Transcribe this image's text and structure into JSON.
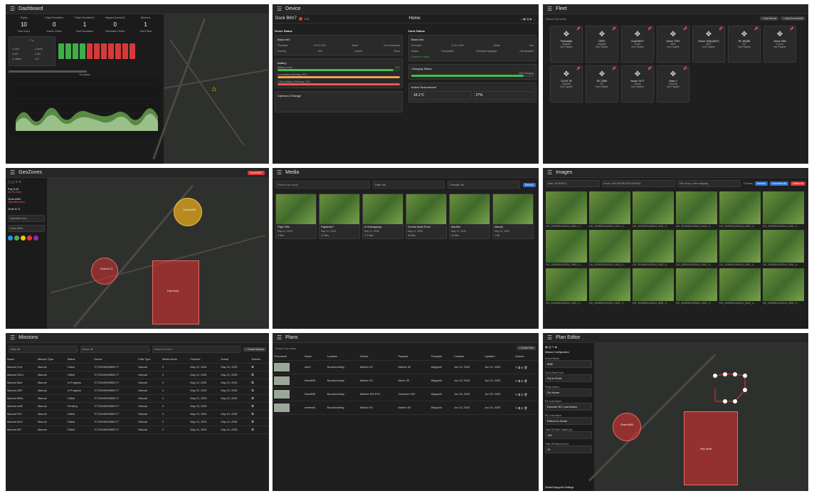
{
  "dashboard": {
    "title": "Dashboard",
    "stats": [
      {
        "label": "Flights",
        "value": "10",
        "sub": "Total Hours"
      },
      {
        "label": "Flight Simulation",
        "value": "0",
        "sub": "Assets Online"
      },
      {
        "label": "Flight Simulation2",
        "value": "1",
        "sub": "Total Simulation"
      },
      {
        "label": "Mapped Area(m2)",
        "value": "0",
        "sub": "Simulation Online"
      },
      {
        "label": "Missions",
        "value": "1",
        "sub": "Total Plans"
      }
    ],
    "fly_status": "Fly status",
    "battery_label": "Fly"
  },
  "device": {
    "title": "Device",
    "dock_name": "Dock B6V7",
    "dji_label": "DJI",
    "home_label": "Home",
    "drone_status": "Drone Status",
    "dock_status": "Dock Status",
    "basic_info": "Basic Info",
    "battery": "Battery",
    "camera_storage": "Camera & Storage",
    "charging_status": "Charging Status",
    "indoor_env": "Indoor Environment",
    "firmware": "Firmware",
    "firmware_val": "10.01.1001",
    "mode": "Mode",
    "mode_val": "Not connected",
    "country": "Country",
    "country_val": "N/A",
    "control": "Control",
    "control_val": "Rock",
    "battery_level": "Battery Level",
    "battery_pct": "29%",
    "low_batt": "Low Battery Warning: 30%",
    "crit_batt": "Critical Battery Warning: 10%",
    "temp_val": "18.1°C",
    "humidity_val": "27%",
    "charging_state": "Not Charging",
    "dock_mode": "Idle",
    "status": "Status",
    "status_val": "Compatible",
    "firmware_upgrade": "Firmware Upgrade",
    "fu_val": "Not Updated",
    "drone_in_dock": "Drone is in dock"
  },
  "fleet": {
    "title": "Fleet",
    "search": "Search by name",
    "add_device": "+ Add Device",
    "add_dock": "+ Add Dock Model",
    "items": [
      {
        "name": "Testzastrip",
        "sub": "Adapter",
        "status": "Not Flyable"
      },
      {
        "name": "GPR1",
        "sub": "Adapter",
        "status": "Not Flyable"
      },
      {
        "name": "Dock B6V7",
        "sub": "Dock",
        "status": "Not Flyable"
      },
      {
        "name": "Drone 7V9X",
        "sub": "M30",
        "status": "Not Flyable"
      },
      {
        "name": "Drone JX4A (M3T)",
        "sub": "M3T",
        "status": "Not Flyable"
      },
      {
        "name": "RC WQ8N",
        "sub": "RC",
        "status": "Not Flyable"
      },
      {
        "name": "Drone 0SB",
        "sub": "Drone",
        "status": "Not Flyable"
      },
      {
        "name": "DJI AT 25",
        "sub": "Camera",
        "status": "Not Flyable"
      },
      {
        "name": "RC 2S83",
        "sub": "RC",
        "status": "Not Flyable"
      },
      {
        "name": "Drone 7A7T",
        "sub": "Drone",
        "status": "Not Flyable"
      },
      {
        "name": "Video 1",
        "sub": "Camera",
        "status": "Not Flyable"
      }
    ]
  },
  "geozones": {
    "title": "GeoZones",
    "dock_btn": "Dock B6V7",
    "zones": [
      {
        "name": "Poly N-29",
        "type": "No Fly Zone"
      },
      {
        "name": "Circle A453",
        "type": "Operation Area"
      },
      {
        "name": "Circle N-71",
        "type": ""
      }
    ],
    "field_label": "Operation Area",
    "name_label": "Circle A453",
    "labels": {
      "circle_a": "Circle A453",
      "circle_b": "Circle N-71",
      "poly": "Poly Scott"
    }
  },
  "media": {
    "title": "Media",
    "search": "Search by name",
    "filter1": "Date: All",
    "filter2": "Format: All",
    "refresh": "Refresh",
    "items": [
      {
        "name": "Flight 7e5e",
        "date": "May 11, 2025",
        "count": "4 files"
      },
      {
        "name": "Flightcode7",
        "date": "May 11, 2025",
        "count": "21 files"
      },
      {
        "name": "et Geomapping",
        "date": "May 11, 2025",
        "count": "172 files"
      },
      {
        "name": "Circular Aerial Event",
        "date": "May 11, 2025",
        "count": "36 files"
      },
      {
        "name": "Niceflix4",
        "date": "May 11, 2025",
        "count": "18 files"
      },
      {
        "name": "Manual",
        "date": "May 11, 2025",
        "count": "1 file"
      }
    ]
  },
  "images": {
    "title": "Images",
    "filter1": "Date: 2025/05/11",
    "filter2": "Drone: 5DCF8F4B23FA7E2E3A4",
    "filter3": "File Group: ortho mapping",
    "count": "72 Items",
    "refresh": "Refresh",
    "download": "Download All",
    "delete": "Delete All",
    "caption": "DJI_20250511102514_0001_V..."
  },
  "missions": {
    "title": "Missions",
    "filter1": "Date: All",
    "filter2": "Drone: All",
    "search": "Search by name",
    "create": "+ Create Mission",
    "headers": [
      "Name",
      "Mission Type",
      "Status",
      "Device",
      "Path Type",
      "Media Items",
      "Planned",
      "Actual",
      "Actions"
    ],
    "rows": [
      {
        "name": "Manual 4Yre",
        "type": "Manual",
        "sub": "1 Key Takeoff",
        "status": "Failed",
        "device": "7CT394H0D08BVY7",
        "path": "Manual",
        "media": "0",
        "planned": "May 22, 2025",
        "ptime": "12:47 - 13:47",
        "actual": "May 22, 2025",
        "atime": "13:47 - 13:47"
      },
      {
        "name": "Manual-TACs",
        "type": "Manual",
        "sub": "1 Key Takeoff",
        "status": "Failed",
        "device": "7CT394H0D08BVY7",
        "path": "Manual",
        "media": "0",
        "planned": "May 22, 2025",
        "ptime": "12:47 - 12:47",
        "actual": "May 22, 2025",
        "atime": "12:47 - 12:47"
      },
      {
        "name": "Manual-Skat",
        "type": "Manual",
        "sub": "1 Key Takeoff",
        "status": "In Progress",
        "device": "7CT394H0D08BVY7",
        "path": "Manual",
        "media": "0",
        "planned": "May 22, 2025",
        "ptime": "12:47 - 13:47",
        "actual": "May 22, 2025",
        "atime": "12:47 - 13:47"
      },
      {
        "name": "Manual-4WT",
        "type": "Manual",
        "sub": "1 Key Takeoff",
        "status": "In Progress",
        "device": "7CT394H0D08BVY7",
        "path": "Manual",
        "media": "0",
        "planned": "May 22, 2025",
        "ptime": "12:47 - 13:47",
        "actual": "May 22, 2025",
        "atime": "12:47 - 13:47"
      },
      {
        "name": "Manual-8R6c",
        "type": "Manual",
        "sub": "1 Key Takeoff",
        "status": "Failed",
        "device": "7CT394H0D08BVY7",
        "path": "Manual",
        "media": "0",
        "planned": "May 22, 2025",
        "ptime": "12:47 - 12:47",
        "actual": "May 22, 2025",
        "atime": "12:47 - 12:47"
      },
      {
        "name": "Manual-m4B",
        "type": "Manual",
        "sub": "1 Key Takeoff",
        "status": "Pending",
        "device": "7CT394H0D08BVY7",
        "path": "Manual",
        "media": "0",
        "planned": "May 25, 2025",
        "ptime": "11:06 - 11:06",
        "actual": "",
        "atime": ""
      },
      {
        "name": "Manual-FK2",
        "type": "Manual",
        "sub": "1 Key Takeoff",
        "status": "Failed",
        "device": "7CT394H0D08BVY7",
        "path": "Manual",
        "media": "0",
        "planned": "May 24, 2025",
        "ptime": "10:09 - 10:09",
        "actual": "May 24, 2025",
        "atime": "10:09 - 10:09"
      },
      {
        "name": "Manual-SoM",
        "type": "Manual",
        "sub": "1 Key Takeoff",
        "status": "Failed",
        "device": "7CT394H0D08BVY7",
        "path": "Manual",
        "media": "0",
        "planned": "May 24, 2025",
        "ptime": "10:09 - 10:09",
        "actual": "May 24, 2025",
        "atime": "10:09 - 10:09"
      },
      {
        "name": "Manual-9KT",
        "type": "Manual",
        "sub": "1 Key Takeoff",
        "status": "Failed",
        "device": "7CT394H0D08BVY7",
        "path": "Manual",
        "media": "0",
        "planned": "May 24, 2025",
        "ptime": "10:09 - 10:09",
        "actual": "May 24, 2025",
        "atime": "10:09 - 10:09"
      },
      {
        "name": "Manual-Ye6r",
        "type": "Manual",
        "sub": "1 Key Takeoff",
        "status": "Failed",
        "device": "7CT394H0D08BVY7",
        "path": "Manual",
        "media": "0",
        "planned": "May 24, 2025",
        "ptime": "10:17 - 10:17",
        "actual": "May 24, 2025",
        "atime": "10:17 - 10:17"
      },
      {
        "name": "Manual-7Ft4",
        "type": "Manual",
        "sub": "1 Key Takeoff",
        "status": "Failed",
        "device": "7CT394H0D08BVY7",
        "path": "Manual",
        "media": "0",
        "planned": "May 18, 2025",
        "ptime": "10:08 - 10:08",
        "actual": "May 18, 2025",
        "atime": "10:08 - 10:08"
      }
    ]
  },
  "plans": {
    "title": "Plans",
    "search": "Search by name",
    "create": "+ Create Plan",
    "headers": [
      "Thumbnail",
      "Name",
      "Location",
      "Device",
      "Payload",
      "Template",
      "Created",
      "Updated",
      "Actions"
    ],
    "rows": [
      {
        "name": "new7",
        "location": "Braunschweig",
        "device": "Matrice 30",
        "payload": "Matrice 30",
        "template": "Waypoint",
        "created": "Jun 10, 2025",
        "ctime": "10:47",
        "updated": "Jun 10, 2025",
        "utime": "10:47"
      },
      {
        "name": "Newr606",
        "location": "Braunschweig",
        "device": "Matrice 30",
        "payload": "Mavic 3E",
        "template": "Waypoint",
        "created": "Jun 10, 2025",
        "ctime": "17:00",
        "updated": "Jun 10, 2025",
        "utime": "17:00"
      },
      {
        "name": "Newr606",
        "location": "Braunschweig",
        "device": "Matrice 300 RTK",
        "payload": "Zenmuse H20",
        "template": "Waypoint",
        "created": "Jun 05, 2025",
        "ctime": "20:53",
        "updated": "Jun 05, 2025",
        "utime": "20:53"
      },
      {
        "name": "newtest4",
        "location": "Braunschweig",
        "device": "Matrice 30",
        "payload": "Matrice 30",
        "template": "Waypoint",
        "created": "Jun 10, 2025",
        "ctime": "16:28",
        "updated": "Jun 04, 2025",
        "utime": "16:28"
      }
    ]
  },
  "planeditor": {
    "title": "Plan Editor",
    "section": "Mission Configuration",
    "fields": [
      {
        "label": "Drone Model",
        "value": "M3E"
      },
      {
        "label": "Fly to Start Point",
        "value": "Fly to Point"
      },
      {
        "label": "Finish Action",
        "value": "Go Home"
      },
      {
        "label": "RC Lost Action",
        "value": "Execute RC Lost Action"
      },
      {
        "label": "RC Lost Action",
        "value": "Return to Home"
      },
      {
        "label": "Take Off Safe Height (m)",
        "value": "120"
      },
      {
        "label": "Take Off Speed (m/s)",
        "value": "10"
      }
    ],
    "footer": "Default Waypoint Settings",
    "circle": "Circle A453",
    "poly": "Poly Scott"
  }
}
